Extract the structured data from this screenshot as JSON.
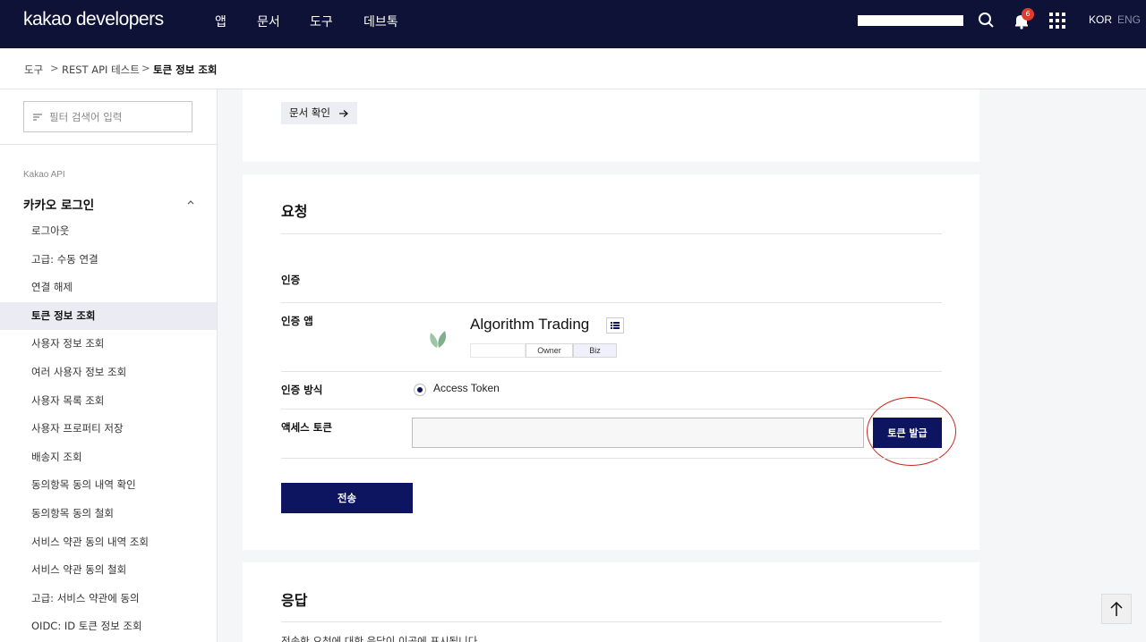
{
  "topbar": {
    "logo": "kakao developers",
    "nav": [
      "앱",
      "문서",
      "도구",
      "데브톡"
    ],
    "notification_count": "6",
    "lang_kor": "KOR",
    "lang_eng": "ENG"
  },
  "breadcrumb": [
    "도구",
    "REST API 테스트",
    "토큰 정보 조회"
  ],
  "sidebar": {
    "filter_placeholder": "필터 검색어 입력",
    "section": "Kakao API",
    "group": "카카오 로그인",
    "items": [
      {
        "label": "로그아웃"
      },
      {
        "label": "고급: 수동 연결"
      },
      {
        "label": "연결 해제"
      },
      {
        "label": "토큰 정보 조회",
        "active": true
      },
      {
        "label": "사용자 정보 조회"
      },
      {
        "label": "여러 사용자 정보 조회"
      },
      {
        "label": "사용자 목록 조회"
      },
      {
        "label": "사용자 프로퍼티 저장"
      },
      {
        "label": "배송지 조회"
      },
      {
        "label": "동의항목 동의 내역 확인"
      },
      {
        "label": "동의항목 동의 철회"
      },
      {
        "label": "서비스 약관 동의 내역 조회"
      },
      {
        "label": "서비스 약관 동의 철회"
      },
      {
        "label": "고급: 서비스 약관에 동의"
      },
      {
        "label": "OIDC: ID 토큰 정보 조회"
      }
    ]
  },
  "doc_card": {
    "doc_button": "문서 확인"
  },
  "request": {
    "title": "요청",
    "auth_heading": "인증",
    "auth_app_label": "인증 앱",
    "app_name": "Algorithm Trading",
    "tags": [
      "Owner",
      "Biz"
    ],
    "auth_method_label": "인증 방식",
    "auth_method_value": "Access Token",
    "access_token_label": "액세스 토큰",
    "issue_token_button": "토큰 발급",
    "submit_button": "전송"
  },
  "response": {
    "title": "응답",
    "text": "전송한 요청에 대한 응답이 이곳에 표시됩니다."
  },
  "colors": {
    "nav_bg": "#0d1236",
    "primary": "#0d1560",
    "highlight": "#c8281e",
    "badge": "#e03b2f"
  }
}
